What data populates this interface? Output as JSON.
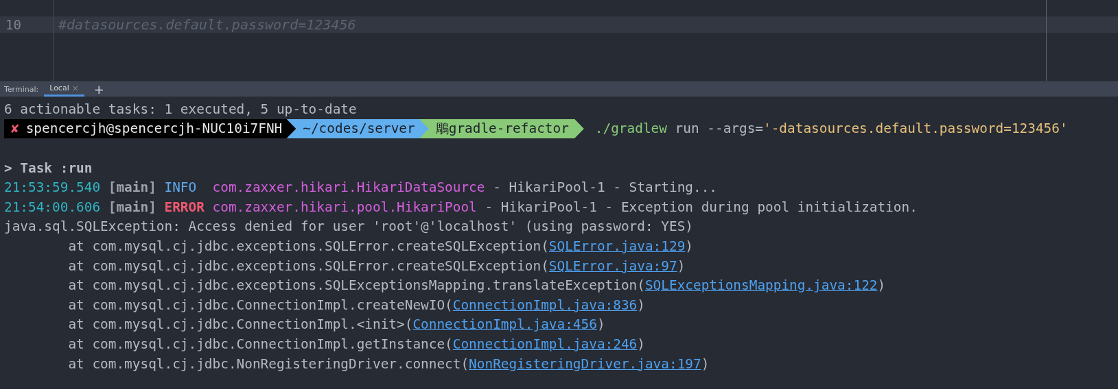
{
  "editor": {
    "lines": [
      {
        "number": "10",
        "text": "#datasources.default.password=123456",
        "current": true
      }
    ]
  },
  "terminal": {
    "label": "Terminal:",
    "tabs": [
      {
        "label": "Local",
        "close": "×",
        "selected": true
      }
    ],
    "new_tab": "+",
    "lines": [
      {
        "kind": "text",
        "segments": [
          {
            "kind": "plain",
            "text": "6 actionable tasks: 1 executed, 5 up-to-date"
          }
        ]
      },
      {
        "kind": "prompt",
        "status": "✘",
        "user": "spencercjh@spencercjh-NUC10i7FNH",
        "path": "~/codes/server",
        "branch_icon": "鵰",
        "branch": "gradle-refactor",
        "segments": [
          {
            "kind": "cmd",
            "text": "./gradlew"
          },
          {
            "kind": "plain",
            "text": " run --args="
          },
          {
            "kind": "arg",
            "text": "'-datasources.default.password=123456'"
          }
        ]
      },
      {
        "kind": "blank"
      },
      {
        "kind": "text",
        "segments": [
          {
            "kind": "task",
            "text": "> Task :run"
          }
        ]
      },
      {
        "kind": "text",
        "segments": [
          {
            "kind": "time",
            "text": "21:53:59.540 "
          },
          {
            "kind": "thread",
            "text": "[main] "
          },
          {
            "kind": "info",
            "text": "INFO  "
          },
          {
            "kind": "class",
            "text": "com.zaxxer.hikari.HikariDataSource"
          },
          {
            "kind": "plain",
            "text": " - HikariPool-1 - Starting..."
          }
        ]
      },
      {
        "kind": "text",
        "segments": [
          {
            "kind": "time",
            "text": "21:54:00.606 "
          },
          {
            "kind": "thread",
            "text": "[main] "
          },
          {
            "kind": "error",
            "text": "ERROR "
          },
          {
            "kind": "class",
            "text": "com.zaxxer.hikari.pool.HikariPool"
          },
          {
            "kind": "plain",
            "text": " - HikariPool-1 - Exception during pool initialization."
          }
        ]
      },
      {
        "kind": "text",
        "segments": [
          {
            "kind": "plain",
            "text": "java.sql.SQLException: Access denied for user 'root'@'localhost' (using password: YES)"
          }
        ]
      },
      {
        "kind": "text",
        "segments": [
          {
            "kind": "plain",
            "text": "        at com.mysql.cj.jdbc.exceptions.SQLError.createSQLException("
          },
          {
            "kind": "link",
            "text": "SQLError.java:129"
          },
          {
            "kind": "plain",
            "text": ")"
          }
        ]
      },
      {
        "kind": "text",
        "segments": [
          {
            "kind": "plain",
            "text": "        at com.mysql.cj.jdbc.exceptions.SQLError.createSQLException("
          },
          {
            "kind": "link",
            "text": "SQLError.java:97"
          },
          {
            "kind": "plain",
            "text": ")"
          }
        ]
      },
      {
        "kind": "text",
        "segments": [
          {
            "kind": "plain",
            "text": "        at com.mysql.cj.jdbc.exceptions.SQLExceptionsMapping.translateException("
          },
          {
            "kind": "link",
            "text": "SQLExceptionsMapping.java:122"
          },
          {
            "kind": "plain",
            "text": ")"
          }
        ]
      },
      {
        "kind": "text",
        "segments": [
          {
            "kind": "plain",
            "text": "        at com.mysql.cj.jdbc.ConnectionImpl.createNewIO("
          },
          {
            "kind": "link",
            "text": "ConnectionImpl.java:836"
          },
          {
            "kind": "plain",
            "text": ")"
          }
        ]
      },
      {
        "kind": "text",
        "segments": [
          {
            "kind": "plain",
            "text": "        at com.mysql.cj.jdbc.ConnectionImpl.<init>("
          },
          {
            "kind": "link",
            "text": "ConnectionImpl.java:456"
          },
          {
            "kind": "plain",
            "text": ")"
          }
        ]
      },
      {
        "kind": "text",
        "segments": [
          {
            "kind": "plain",
            "text": "        at com.mysql.cj.jdbc.ConnectionImpl.getInstance("
          },
          {
            "kind": "link",
            "text": "ConnectionImpl.java:246"
          },
          {
            "kind": "plain",
            "text": ")"
          }
        ]
      },
      {
        "kind": "text",
        "segments": [
          {
            "kind": "plain",
            "text": "        at com.mysql.cj.jdbc.NonRegisteringDriver.connect("
          },
          {
            "kind": "link",
            "text": "NonRegisteringDriver.java:197"
          },
          {
            "kind": "plain",
            "text": ")"
          }
        ]
      }
    ]
  }
}
